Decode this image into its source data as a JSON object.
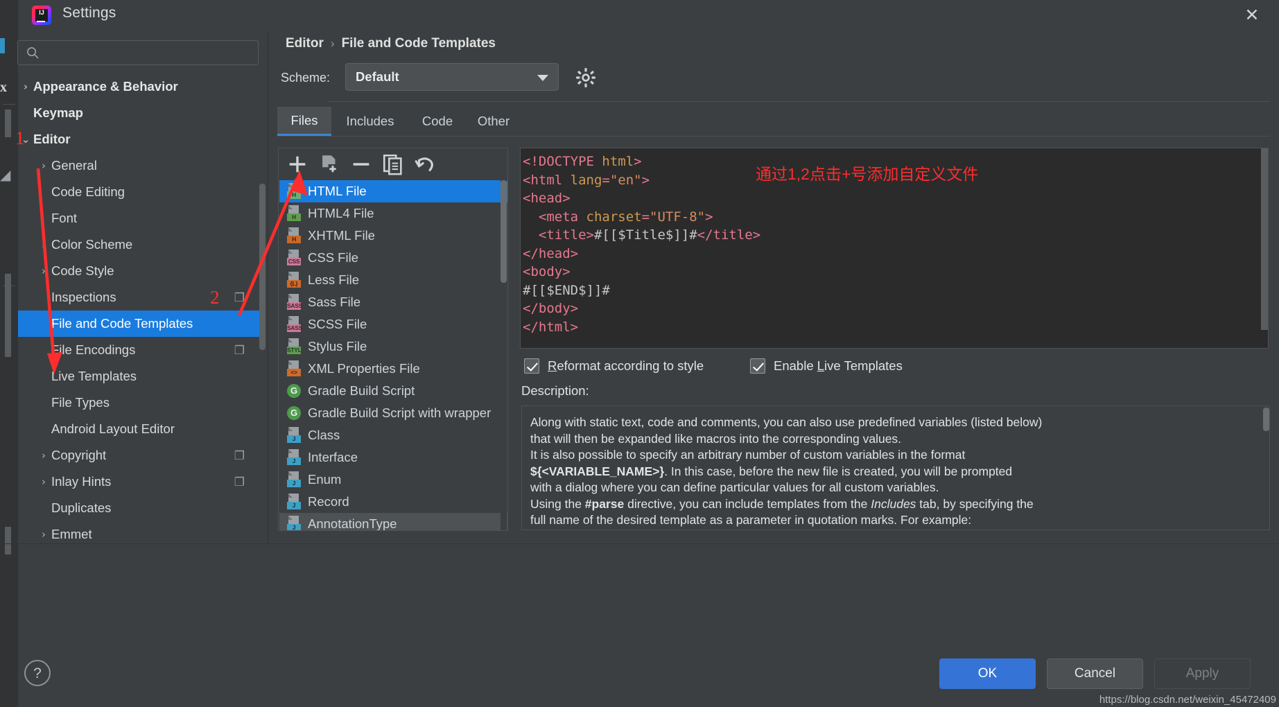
{
  "window": {
    "title": "Settings",
    "logo_text": "IJ",
    "close_icon": "✕"
  },
  "search": {
    "value": "",
    "placeholder": ""
  },
  "sidebar": {
    "items": [
      {
        "label": "Appearance & Behavior",
        "arrow": "›",
        "indent": 0,
        "bold": true,
        "selected": false,
        "copy_icon": false
      },
      {
        "label": "Keymap",
        "arrow": "",
        "indent": 0,
        "bold": true,
        "selected": false,
        "copy_icon": false
      },
      {
        "label": "Editor",
        "arrow": "⌄",
        "indent": 0,
        "bold": true,
        "selected": false,
        "copy_icon": false
      },
      {
        "label": "General",
        "arrow": "›",
        "indent": 1,
        "bold": false,
        "selected": false,
        "copy_icon": false
      },
      {
        "label": "Code Editing",
        "arrow": "",
        "indent": 1,
        "bold": false,
        "selected": false,
        "copy_icon": false
      },
      {
        "label": "Font",
        "arrow": "",
        "indent": 1,
        "bold": false,
        "selected": false,
        "copy_icon": false
      },
      {
        "label": "Color Scheme",
        "arrow": "›",
        "indent": 1,
        "bold": false,
        "selected": false,
        "copy_icon": false
      },
      {
        "label": "Code Style",
        "arrow": "›",
        "indent": 1,
        "bold": false,
        "selected": false,
        "copy_icon": false
      },
      {
        "label": "Inspections",
        "arrow": "",
        "indent": 1,
        "bold": false,
        "selected": false,
        "copy_icon": true
      },
      {
        "label": "File and Code Templates",
        "arrow": "",
        "indent": 1,
        "bold": false,
        "selected": true,
        "copy_icon": false
      },
      {
        "label": "File Encodings",
        "arrow": "",
        "indent": 1,
        "bold": false,
        "selected": false,
        "copy_icon": true
      },
      {
        "label": "Live Templates",
        "arrow": "",
        "indent": 1,
        "bold": false,
        "selected": false,
        "copy_icon": false
      },
      {
        "label": "File Types",
        "arrow": "",
        "indent": 1,
        "bold": false,
        "selected": false,
        "copy_icon": false
      },
      {
        "label": "Android Layout Editor",
        "arrow": "",
        "indent": 1,
        "bold": false,
        "selected": false,
        "copy_icon": false
      },
      {
        "label": "Copyright",
        "arrow": "›",
        "indent": 1,
        "bold": false,
        "selected": false,
        "copy_icon": true
      },
      {
        "label": "Inlay Hints",
        "arrow": "›",
        "indent": 1,
        "bold": false,
        "selected": false,
        "copy_icon": true
      },
      {
        "label": "Duplicates",
        "arrow": "",
        "indent": 1,
        "bold": false,
        "selected": false,
        "copy_icon": false
      },
      {
        "label": "Emmet",
        "arrow": "›",
        "indent": 1,
        "bold": false,
        "selected": false,
        "copy_icon": false
      }
    ]
  },
  "main": {
    "breadcrumb": {
      "parent": "Editor",
      "separator": "›",
      "current": "File and Code Templates"
    },
    "scheme": {
      "label": "Scheme:",
      "value": "Default"
    },
    "gear_icon": "gear-icon",
    "tabs": [
      {
        "label": "Files",
        "active": true
      },
      {
        "label": "Includes",
        "active": false
      },
      {
        "label": "Code",
        "active": false
      },
      {
        "label": "Other",
        "active": false
      }
    ],
    "toolbar": [
      {
        "name": "add-template-button",
        "glyph": "+"
      },
      {
        "name": "copy-template-button",
        "glyph": "copy-file"
      },
      {
        "name": "remove-template-button",
        "glyph": "−"
      },
      {
        "name": "duplicate-button",
        "glyph": "duplicate"
      },
      {
        "name": "reset-button",
        "glyph": "↶"
      }
    ],
    "file_list": [
      {
        "label": "HTML File",
        "badge": "H",
        "badge_bg": "#6cae75",
        "badge_fg": "#1f3d22",
        "type": "doc",
        "selected": true
      },
      {
        "label": "HTML4 File",
        "badge": "H",
        "badge_bg": "#5f9e4e",
        "badge_fg": "#1f3d22",
        "type": "doc",
        "selected": false
      },
      {
        "label": "XHTML File",
        "badge": "H",
        "badge_bg": "#c96a2b",
        "badge_fg": "#3d1f0a",
        "type": "doc",
        "selected": false
      },
      {
        "label": "CSS File",
        "badge": "CSS",
        "badge_bg": "#c97b96",
        "badge_fg": "#4a1f30",
        "type": "doc",
        "selected": false
      },
      {
        "label": "Less File",
        "badge": "{L}",
        "badge_bg": "#cf6a2c",
        "badge_fg": "#3d1f0a",
        "type": "doc",
        "selected": false
      },
      {
        "label": "Sass File",
        "badge": "SASS",
        "badge_bg": "#c97b96",
        "badge_fg": "#4a1f30",
        "type": "doc",
        "selected": false
      },
      {
        "label": "SCSS File",
        "badge": "SASS",
        "badge_bg": "#c97b96",
        "badge_fg": "#4a1f30",
        "type": "doc",
        "selected": false
      },
      {
        "label": "Stylus File",
        "badge": "STYL",
        "badge_bg": "#5f9e4e",
        "badge_fg": "#1f3d22",
        "type": "doc",
        "selected": false
      },
      {
        "label": "XML Properties File",
        "badge": "<>",
        "badge_bg": "#cf6a2c",
        "badge_fg": "#3d1f0a",
        "type": "doc",
        "selected": false
      },
      {
        "label": "Gradle Build Script",
        "badge": "G",
        "badge_bg": "#4e9a4e",
        "badge_fg": "#e9f5e9",
        "type": "circle",
        "selected": false
      },
      {
        "label": "Gradle Build Script with wrapper",
        "badge": "G",
        "badge_bg": "#4e9a4e",
        "badge_fg": "#e9f5e9",
        "type": "circle",
        "selected": false
      },
      {
        "label": "Class",
        "badge": "J",
        "badge_bg": "#3f9fc4",
        "badge_fg": "#0f2d3d",
        "type": "doc",
        "selected": false
      },
      {
        "label": "Interface",
        "badge": "J",
        "badge_bg": "#3f9fc4",
        "badge_fg": "#0f2d3d",
        "type": "doc",
        "selected": false
      },
      {
        "label": "Enum",
        "badge": "J",
        "badge_bg": "#3f9fc4",
        "badge_fg": "#0f2d3d",
        "type": "doc",
        "selected": false
      },
      {
        "label": "Record",
        "badge": "J",
        "badge_bg": "#3f9fc4",
        "badge_fg": "#0f2d3d",
        "type": "doc",
        "selected": false
      },
      {
        "label": "AnnotationType",
        "badge": "J",
        "badge_bg": "#3f9fc4",
        "badge_fg": "#0f2d3d",
        "type": "doc",
        "selected": false,
        "hovered": true
      }
    ],
    "editor_code_lines": [
      [
        {
          "t": "<!DOCTYPE ",
          "c": "tagp"
        },
        {
          "t": "html",
          "c": "attr"
        },
        {
          "t": ">",
          "c": "tagp"
        }
      ],
      [
        {
          "t": "<html ",
          "c": "tagp"
        },
        {
          "t": "lang",
          "c": "attr"
        },
        {
          "t": "=",
          "c": "tagp"
        },
        {
          "t": "\"en\"",
          "c": "val2"
        },
        {
          "t": ">",
          "c": "tagp"
        }
      ],
      [
        {
          "t": "<head>",
          "c": "tagp"
        }
      ],
      [
        {
          "t": "  <meta ",
          "c": "tagp"
        },
        {
          "t": "charset",
          "c": "attr"
        },
        {
          "t": "=",
          "c": "tagp"
        },
        {
          "t": "\"UTF-8\"",
          "c": "val2"
        },
        {
          "t": ">",
          "c": "tagp"
        }
      ],
      [
        {
          "t": "  <title>",
          "c": "tagp"
        },
        {
          "t": "#[[$Title$]]#",
          "c": "plain"
        },
        {
          "t": "</title>",
          "c": "tagp"
        }
      ],
      [
        {
          "t": "</head>",
          "c": "tagp"
        }
      ],
      [
        {
          "t": "<body>",
          "c": "tagp"
        }
      ],
      [
        {
          "t": "#[[$END$]]#",
          "c": "plain"
        }
      ],
      [
        {
          "t": "</body>",
          "c": "tagp"
        }
      ],
      [
        {
          "t": "</html>",
          "c": "tagp"
        }
      ]
    ],
    "checkbox_reformat": {
      "label_a": "R",
      "label_b": "eformat according to style",
      "checked": true
    },
    "checkbox_livetpl": {
      "label_a": "Enable ",
      "label_b": "L",
      "label_c": "ive Templates",
      "checked": true
    },
    "description_label": "Description:",
    "description_text": "Along with static text, code and comments, you can also use predefined variables (listed below)\nthat will then be expanded like macros into the corresponding values.\nIt is also possible to specify an arbitrary number of custom variables in the format\n${<VARIABLE_NAME>}. In this case, before the new file is created, you will be prompted\nwith a dialog where you can define particular values for all custom variables.\nUsing the #parse directive, you can include templates from the Includes tab, by specifying the\nfull name of the desired template as a parameter in quotation marks. For example:\n#parse(\"File Header.java\")"
  },
  "footer": {
    "help_icon": "?",
    "ok": "OK",
    "cancel": "Cancel",
    "apply": "Apply"
  },
  "annotations": {
    "num1": "1",
    "num2": "2",
    "note": "通过1,2点击+号添加自定义文件",
    "color": "#ff2d2d"
  },
  "watermark": {
    "url": "https://blog.csdn.net/weixin_45472409"
  }
}
